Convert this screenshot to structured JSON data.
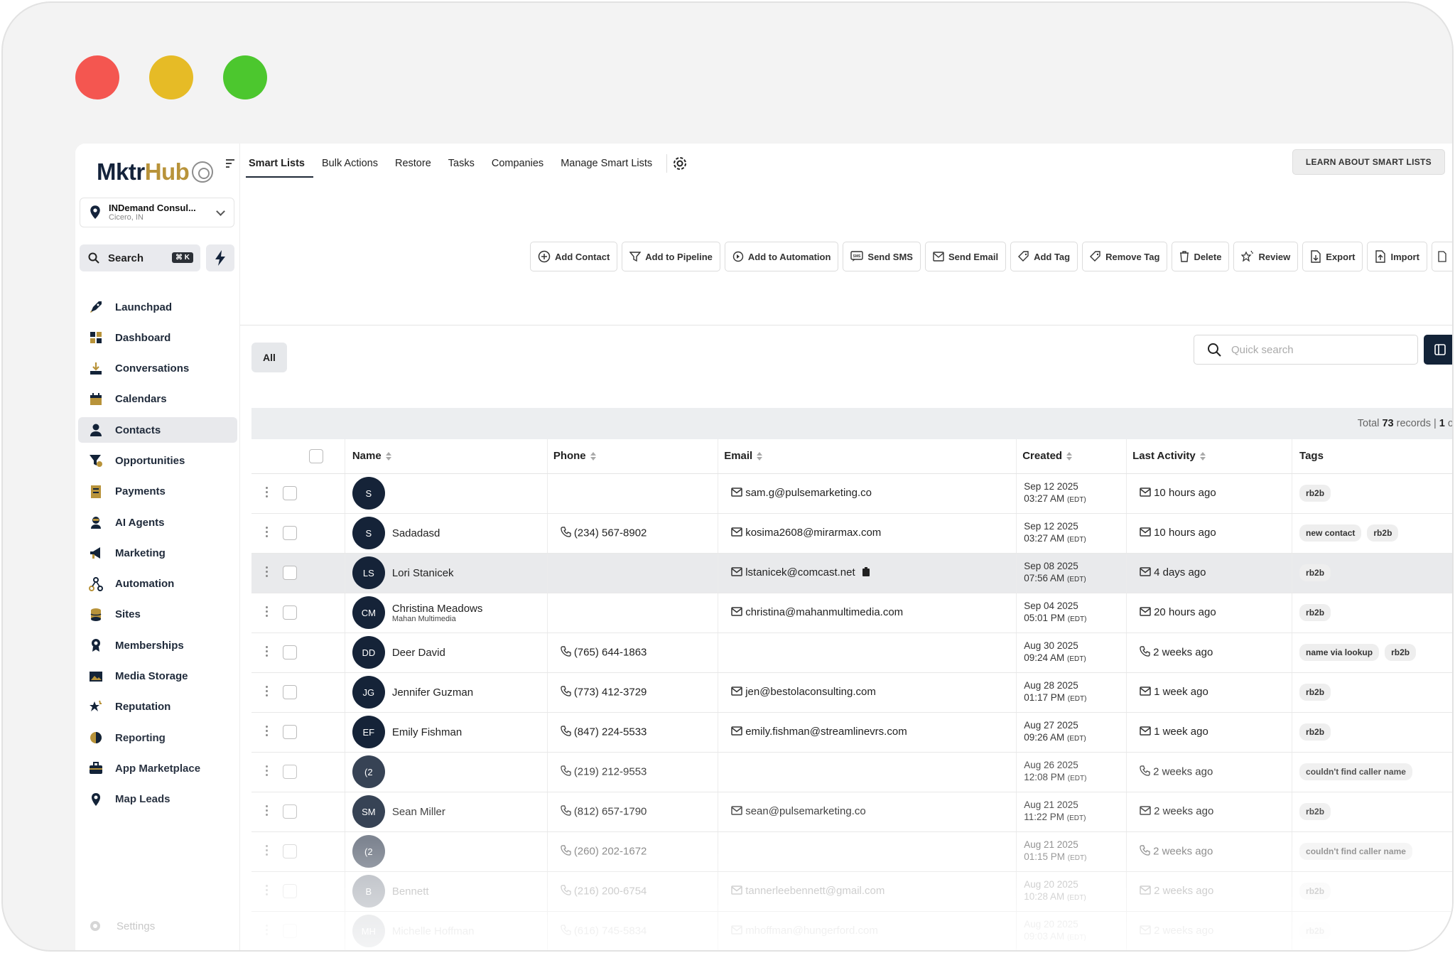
{
  "app": {
    "logo_text_a": "Mktr",
    "logo_text_b": "Hub"
  },
  "account": {
    "name": "INDemand Consul...",
    "location": "Cicero, IN"
  },
  "search": {
    "label": "Search",
    "shortcut": "⌘ K"
  },
  "sidebar": {
    "items": [
      {
        "label": "Launchpad",
        "icon": "rocket-icon"
      },
      {
        "label": "Dashboard",
        "icon": "dashboard-icon"
      },
      {
        "label": "Conversations",
        "icon": "inbox-icon"
      },
      {
        "label": "Calendars",
        "icon": "calendar-icon"
      },
      {
        "label": "Contacts",
        "icon": "user-icon",
        "active": true
      },
      {
        "label": "Opportunities",
        "icon": "funnel-icon"
      },
      {
        "label": "Payments",
        "icon": "payments-icon"
      },
      {
        "label": "AI Agents",
        "icon": "robot-icon"
      },
      {
        "label": "Marketing",
        "icon": "megaphone-icon"
      },
      {
        "label": "Automation",
        "icon": "automation-icon"
      },
      {
        "label": "Sites",
        "icon": "database-icon"
      },
      {
        "label": "Memberships",
        "icon": "award-icon"
      },
      {
        "label": "Media Storage",
        "icon": "image-icon"
      },
      {
        "label": "Reputation",
        "icon": "star-icon"
      },
      {
        "label": "Reporting",
        "icon": "pie-chart-icon"
      },
      {
        "label": "App Marketplace",
        "icon": "briefcase-icon"
      },
      {
        "label": "Map Leads",
        "icon": "map-pin-icon"
      }
    ],
    "settings_label": "Settings"
  },
  "topnav": {
    "tabs": [
      "Smart Lists",
      "Bulk Actions",
      "Restore",
      "Tasks",
      "Companies",
      "Manage Smart Lists"
    ],
    "learn_label": "LEARN ABOUT SMART LISTS"
  },
  "actions": [
    "Add Contact",
    "Add to Pipeline",
    "Add to Automation",
    "Send SMS",
    "Send Email",
    "Add Tag",
    "Remove Tag",
    "Delete",
    "Review",
    "Export",
    "Import"
  ],
  "filter": {
    "all_label": "All",
    "quick_search_placeholder": "Quick search"
  },
  "table": {
    "total_prefix": "Total",
    "total_count": "73",
    "total_suffix": "records |",
    "page": "1",
    "page_suffix": "of",
    "headers": {
      "name": "Name",
      "phone": "Phone",
      "email": "Email",
      "created": "Created",
      "last_activity": "Last Activity",
      "tags": "Tags"
    },
    "rows": [
      {
        "initials": "S",
        "name": "",
        "sub": "",
        "phone": "",
        "email": "sam.g@pulsemarketing.co",
        "created_date": "Sep 12 2025",
        "created_time": "03:27 AM",
        "tz": "(EDT)",
        "activity": "10 hours ago",
        "activity_icon": "mail",
        "tags": [
          "rb2b"
        ]
      },
      {
        "initials": "S",
        "name": "Sadadasd",
        "sub": "",
        "phone": "(234) 567-8902",
        "email": "kosima2608@mirarmax.com",
        "created_date": "Sep 12 2025",
        "created_time": "03:27 AM",
        "tz": "(EDT)",
        "activity": "10 hours ago",
        "activity_icon": "mail",
        "tags": [
          "new contact",
          "rb2b"
        ]
      },
      {
        "initials": "LS",
        "name": "Lori Stanicek",
        "sub": "",
        "phone": "",
        "email": "lstanicek@comcast.net",
        "created_date": "Sep 08 2025",
        "created_time": "07:56 AM",
        "tz": "(EDT)",
        "activity": "4 days ago",
        "activity_icon": "mail",
        "tags": [
          "rb2b"
        ],
        "highlight": true
      },
      {
        "initials": "CM",
        "name": "Christina Meadows",
        "sub": "Mahan Multimedia",
        "phone": "",
        "email": "christina@mahanmultimedia.com",
        "created_date": "Sep 04 2025",
        "created_time": "05:01 PM",
        "tz": "(EDT)",
        "activity": "20 hours ago",
        "activity_icon": "mail",
        "tags": [
          "rb2b"
        ]
      },
      {
        "initials": "DD",
        "name": "Deer David",
        "sub": "",
        "phone": "(765) 644-1863",
        "email": "",
        "created_date": "Aug 30 2025",
        "created_time": "09:24 AM",
        "tz": "(EDT)",
        "activity": "2 weeks ago",
        "activity_icon": "phone",
        "tags": [
          "name via lookup",
          "rb2b"
        ]
      },
      {
        "initials": "JG",
        "name": "Jennifer Guzman",
        "sub": "",
        "phone": "(773) 412-3729",
        "email": "jen@bestolaconsulting.com",
        "created_date": "Aug 28 2025",
        "created_time": "01:17 PM",
        "tz": "(EDT)",
        "activity": "1 week ago",
        "activity_icon": "mail",
        "tags": [
          "rb2b"
        ]
      },
      {
        "initials": "EF",
        "name": "Emily Fishman",
        "sub": "",
        "phone": "(847) 224-5533",
        "email": "emily.fishman@streamlinevrs.com",
        "created_date": "Aug 27 2025",
        "created_time": "09:26 AM",
        "tz": "(EDT)",
        "activity": "1 week ago",
        "activity_icon": "mail",
        "tags": [
          "rb2b"
        ]
      },
      {
        "initials": "(2",
        "name": "",
        "sub": "",
        "phone": "(219) 212-9553",
        "email": "",
        "created_date": "Aug 26 2025",
        "created_time": "12:08 PM",
        "tz": "(EDT)",
        "activity": "2 weeks ago",
        "activity_icon": "phone",
        "tags": [
          "couldn't find caller name"
        ]
      },
      {
        "initials": "SM",
        "name": "Sean Miller",
        "sub": "",
        "phone": "(812) 657-1790",
        "email": "sean@pulsemarketing.co",
        "created_date": "Aug 21 2025",
        "created_time": "11:22 PM",
        "tz": "(EDT)",
        "activity": "2 weeks ago",
        "activity_icon": "mail",
        "tags": [
          "rb2b"
        ]
      },
      {
        "initials": "(2",
        "name": "",
        "sub": "",
        "phone": "(260) 202-1672",
        "email": "",
        "created_date": "Aug 21 2025",
        "created_time": "01:15 PM",
        "tz": "(EDT)",
        "activity": "2 weeks ago",
        "activity_icon": "phone",
        "tags": [
          "couldn't find caller name"
        ]
      },
      {
        "initials": "B",
        "name": "Bennett",
        "sub": "",
        "phone": "(216) 200-6754",
        "email": "tannerleebennett@gmail.com",
        "created_date": "Aug 20 2025",
        "created_time": "10:28 AM",
        "tz": "(EDT)",
        "activity": "2 weeks ago",
        "activity_icon": "mail",
        "tags": [
          "rb2b"
        ]
      },
      {
        "initials": "MH",
        "name": "Michelle Hoffman",
        "sub": "",
        "phone": "(616) 745-5834",
        "email": "mhoffman@hungerford.com",
        "created_date": "Aug 20 2025",
        "created_time": "09:03 AM",
        "tz": "(EDT)",
        "activity": "2 weeks ago",
        "activity_icon": "mail",
        "tags": [
          "rb2b"
        ]
      }
    ]
  },
  "colors": {
    "navy": "#132338",
    "gold": "#b8933a",
    "traffic_red": "#f45650",
    "traffic_yellow": "#e6bb26",
    "traffic_green": "#4cc72e"
  }
}
